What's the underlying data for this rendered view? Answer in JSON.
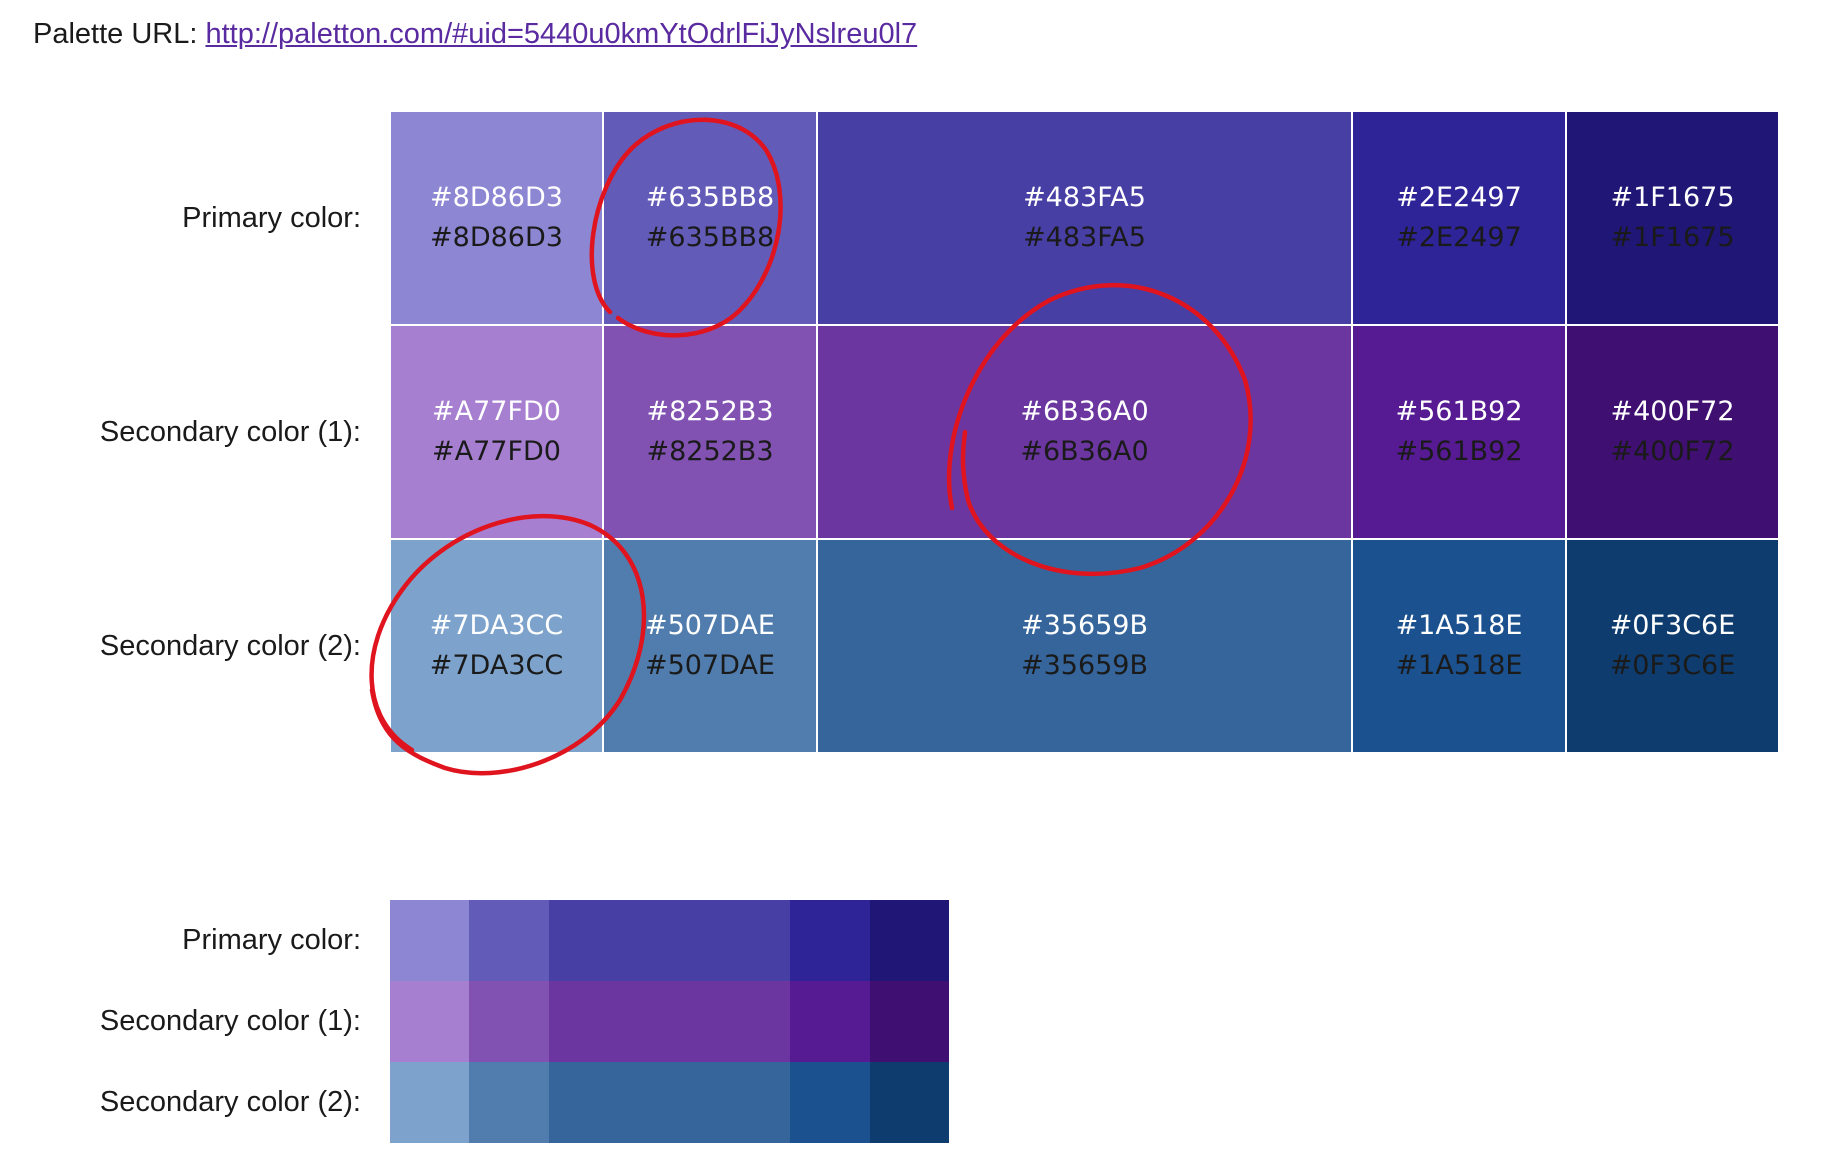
{
  "palette_url": {
    "label": "Palette URL:",
    "link_text": "http://paletton.com/#uid=5440u0kmYtOdrlFiJyNslreu0l7"
  },
  "rows": [
    {
      "label": "Primary color:",
      "colors": [
        "#8D86D3",
        "#635BB8",
        "#483FA5",
        "#2E2497",
        "#1F1675"
      ]
    },
    {
      "label": "Secondary color (1):",
      "colors": [
        "#A77FD0",
        "#8252B3",
        "#6B36A0",
        "#561B92",
        "#400F72"
      ]
    },
    {
      "label": "Secondary color (2):",
      "colors": [
        "#7DA3CC",
        "#507DAE",
        "#35659B",
        "#1A518E",
        "#0F3C6E"
      ]
    }
  ],
  "annotation_color": "#e0141e"
}
